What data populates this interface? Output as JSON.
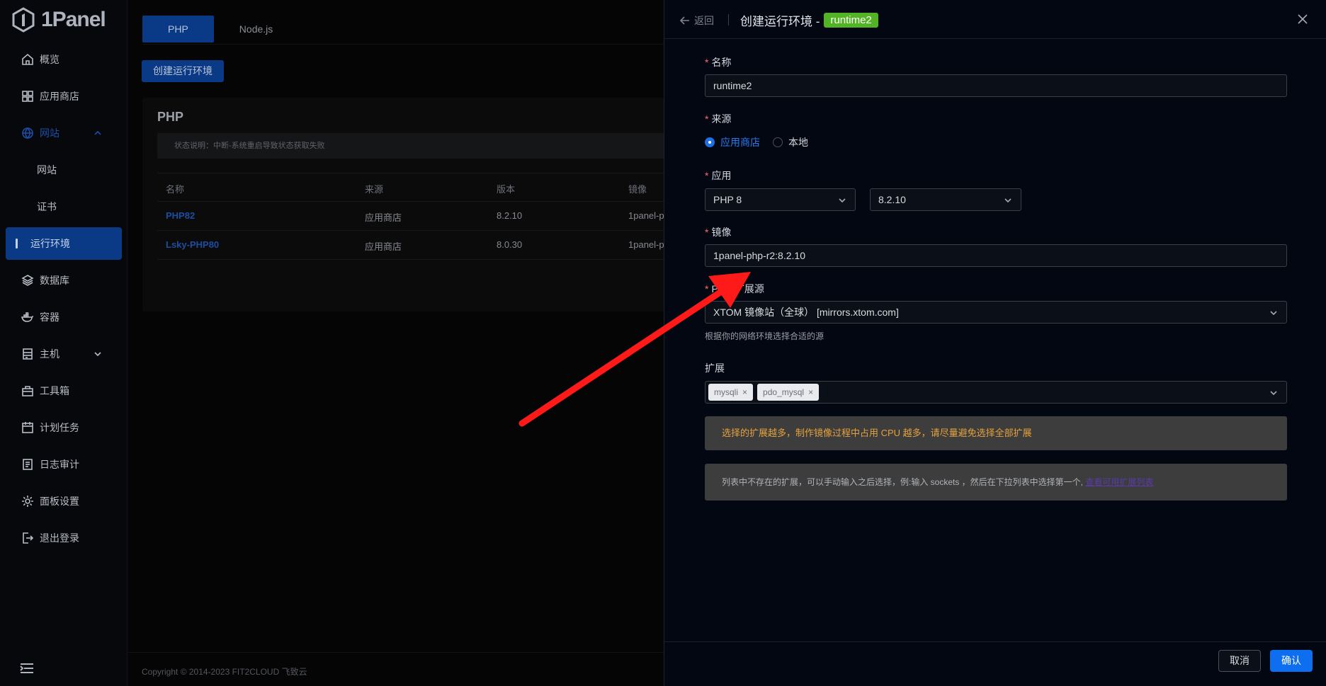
{
  "brand": {
    "name": "1Panel"
  },
  "sidebar": {
    "items": [
      {
        "label": "概览",
        "icon": "home-icon"
      },
      {
        "label": "应用商店",
        "icon": "grid-icon"
      },
      {
        "label": "网站",
        "icon": "globe-icon"
      },
      {
        "label": "网站",
        "icon": ""
      },
      {
        "label": "证书",
        "icon": ""
      },
      {
        "label": "运行环境",
        "icon": ""
      },
      {
        "label": "数据库",
        "icon": "layers-icon"
      },
      {
        "label": "容器",
        "icon": "docker-icon"
      },
      {
        "label": "主机",
        "icon": "server-icon"
      },
      {
        "label": "工具箱",
        "icon": "toolbox-icon"
      },
      {
        "label": "计划任务",
        "icon": "calendar-icon"
      },
      {
        "label": "日志审计",
        "icon": "log-icon"
      },
      {
        "label": "面板设置",
        "icon": "gear-icon"
      },
      {
        "label": "退出登录",
        "icon": "logout-icon"
      }
    ]
  },
  "main": {
    "tabs": [
      "PHP",
      "Node.js"
    ],
    "create_button": "创建运行环境",
    "card_title": "PHP",
    "notice": "状态说明：中断-系统重启导致状态获取失败",
    "table": {
      "headers": [
        "名称",
        "来源",
        "版本",
        "镜像"
      ],
      "rows": [
        [
          "PHP82",
          "应用商店",
          "8.2.10",
          "1panel-p"
        ],
        [
          "Lsky-PHP80",
          "应用商店",
          "8.0.30",
          "1panel-p"
        ]
      ]
    },
    "copyright": "Copyright © 2014-2023 FIT2CLOUD 飞致云"
  },
  "drawer": {
    "back_label": "返回",
    "title": "创建运行环境 -",
    "title_tag": "runtime2",
    "fields": {
      "name_label": "名称",
      "name_value": "runtime2",
      "source_label": "来源",
      "source_options": [
        "应用商店",
        "本地"
      ],
      "app_label": "应用",
      "app_value": "PHP 8",
      "version_value": "8.2.10",
      "image_label": "镜像",
      "image_value": "1panel-php-r2:8.2.10",
      "ext_source_label": "PHP 扩展源",
      "ext_source_value": "XTOM 镜像站（全球） [mirrors.xtom.com]",
      "ext_source_hint": "根据你的网络环境选择合适的源",
      "extensions_label": "扩展",
      "extensions": [
        "mysqli",
        "pdo_mysql"
      ],
      "warn_text": "选择的扩展越多，制作镜像过程中占用 CPU 越多，请尽量避免选择全部扩展",
      "info_text": "列表中不存在的扩展，可以手动输入之后选择，例:输入 sockets ，然后在下拉列表中选择第一个,",
      "info_link": "查看可用扩展列表"
    },
    "cancel_label": "取消",
    "confirm_label": "确认"
  },
  "colors": {
    "primary": "#0d6ef0",
    "tag_green": "#52b424",
    "warn": "#e6a23c",
    "annotation_arrow": "#ff1a1a"
  }
}
